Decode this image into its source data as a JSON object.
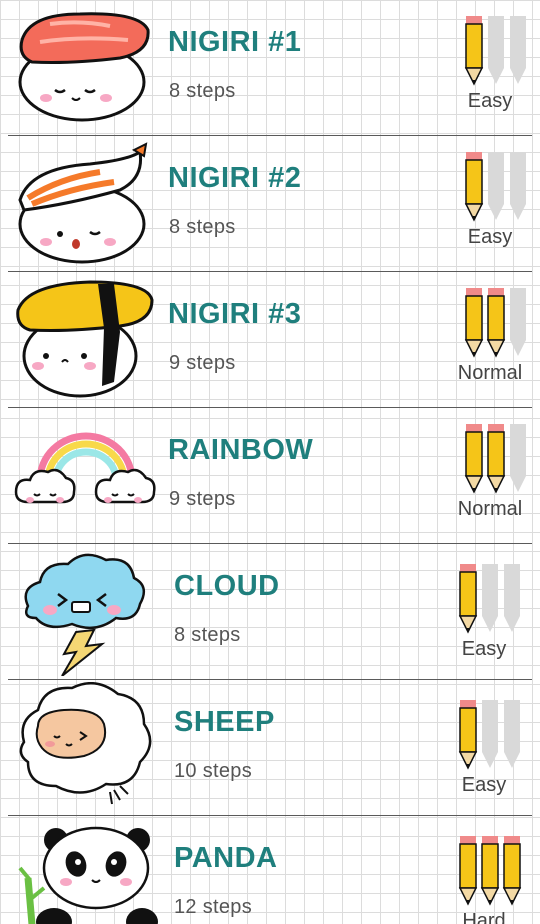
{
  "items": [
    {
      "title": "NIGIRI #1",
      "steps": "8 steps",
      "difficulty": "Easy",
      "level": 1,
      "icon": "salmon-nigiri-icon"
    },
    {
      "title": "NIGIRI #2",
      "steps": "8 steps",
      "difficulty": "Easy",
      "level": 1,
      "icon": "shrimp-nigiri-icon"
    },
    {
      "title": "NIGIRI #3",
      "steps": "9 steps",
      "difficulty": "Normal",
      "level": 2,
      "icon": "tamago-nigiri-icon"
    },
    {
      "title": "RAINBOW",
      "steps": "9 steps",
      "difficulty": "Normal",
      "level": 2,
      "icon": "rainbow-icon"
    },
    {
      "title": "CLOUD",
      "steps": "8 steps",
      "difficulty": "Easy",
      "level": 1,
      "icon": "storm-cloud-icon"
    },
    {
      "title": "SHEEP",
      "steps": "10 steps",
      "difficulty": "Easy",
      "level": 1,
      "icon": "sheep-icon"
    },
    {
      "title": "PANDA",
      "steps": "12 steps",
      "difficulty": "Hard",
      "level": 3,
      "icon": "panda-icon"
    }
  ],
  "colors": {
    "title": "#1f7f7d",
    "pencil_yellow": "#f5c518",
    "pencil_gray": "#d9d9d9",
    "eraser": "#f08a8a"
  }
}
